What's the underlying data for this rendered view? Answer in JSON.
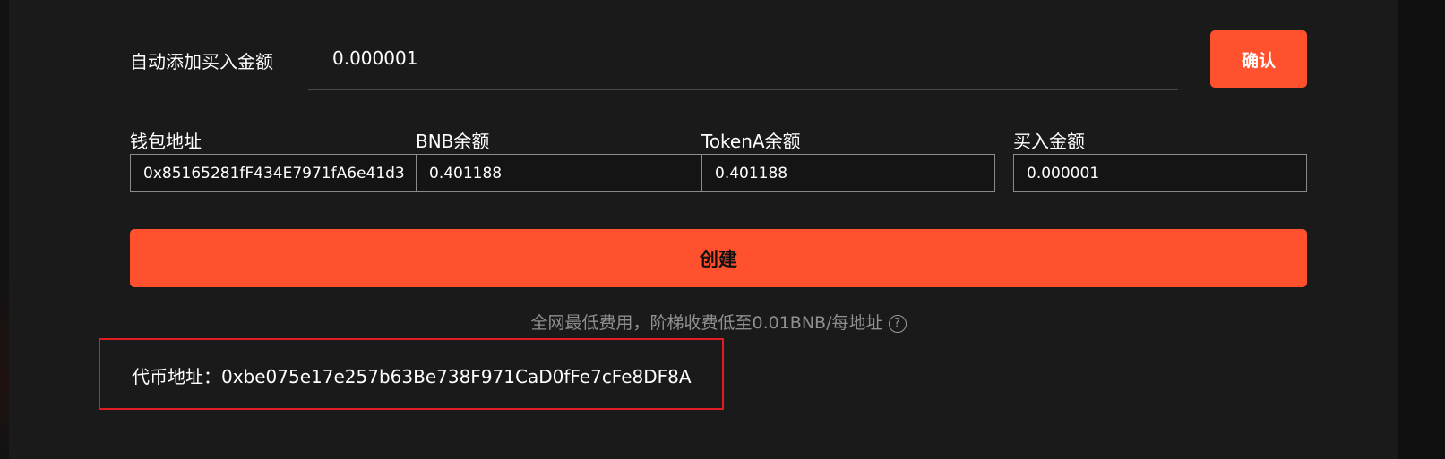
{
  "auto_add": {
    "label": "自动添加买入金额",
    "value": "0.000001",
    "confirm_label": "确认"
  },
  "fields": [
    {
      "label": "钱包地址",
      "value": "0x85165281fF434E7971fA6e41d3"
    },
    {
      "label": "BNB余额",
      "value": "0.401188"
    },
    {
      "label": "TokenA余额",
      "value": "0.401188"
    },
    {
      "label": "买入金额",
      "value": "0.000001"
    }
  ],
  "create_label": "创建",
  "fee_note": "全网最低费用，阶梯收费低至0.01BNB/每地址",
  "help_icon_glyph": "?",
  "token_address": {
    "text": "代币地址：0xbe075e17e257b63Be738F971CaD0fFe7cFe8DF8A"
  },
  "colors": {
    "accent": "#ff512e",
    "highlight_box": "#e01b22",
    "background": "#1a1a1a"
  }
}
